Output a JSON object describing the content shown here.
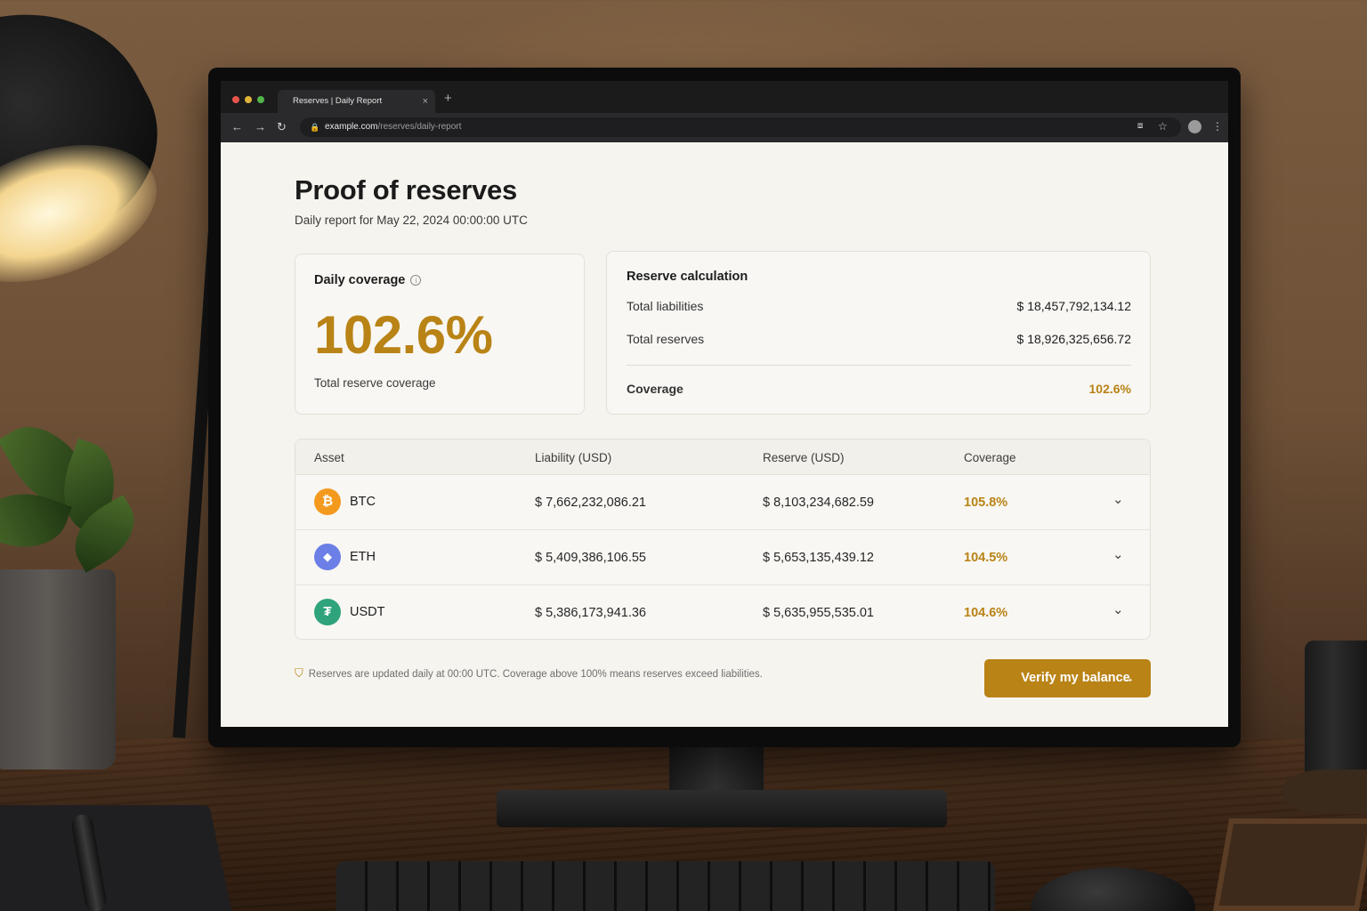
{
  "browser": {
    "tab_title": "Reserves | Daily Report",
    "tab_close": "×",
    "new_tab": "+",
    "url_host": "example.com",
    "url_path": "/reserves/daily-report"
  },
  "page": {
    "title": "Proof of reserves",
    "subtitle": "Daily report for May 22, 2024 00:00:00 UTC"
  },
  "coverage_card": {
    "label": "Daily coverage",
    "value": "102.6%",
    "caption": "Total reserve coverage"
  },
  "calc_card": {
    "title": "Reserve calculation",
    "liabilities_label": "Total liabilities",
    "liabilities_value": "$ 18,457,792,134.12",
    "reserves_label": "Total reserves",
    "reserves_value": "$ 18,926,325,656.72",
    "coverage_label": "Coverage",
    "coverage_value": "102.6%"
  },
  "table": {
    "headers": [
      "Asset",
      "Liability (USD)",
      "Reserve (USD)",
      "Coverage"
    ],
    "rows": [
      {
        "asset": "BTC",
        "icon": "bitcoin-icon",
        "glyph": "₿",
        "color": "#f39a1e",
        "liability": "$ 7,662,232,086.21",
        "reserve": "$ 8,103,234,682.59",
        "coverage": "105.8%"
      },
      {
        "asset": "ETH",
        "icon": "ethereum-icon",
        "glyph": "◆",
        "color": "#6b7fe6",
        "liability": "$ 5,409,386,106.55",
        "reserve": "$ 5,653,135,439.12",
        "coverage": "104.5%"
      },
      {
        "asset": "USDT",
        "icon": "tether-icon",
        "glyph": "₮",
        "color": "#2fa37b",
        "liability": "$ 5,386,173,941.36",
        "reserve": "$ 5,635,955,535.01",
        "coverage": "104.6%"
      }
    ]
  },
  "footer": {
    "note": "Reserves are updated daily at 00:00 UTC. Coverage above 100% means reserves exceed liabilities.",
    "verify_label": "Verify my balance"
  },
  "colors": {
    "accent": "#b98316"
  }
}
